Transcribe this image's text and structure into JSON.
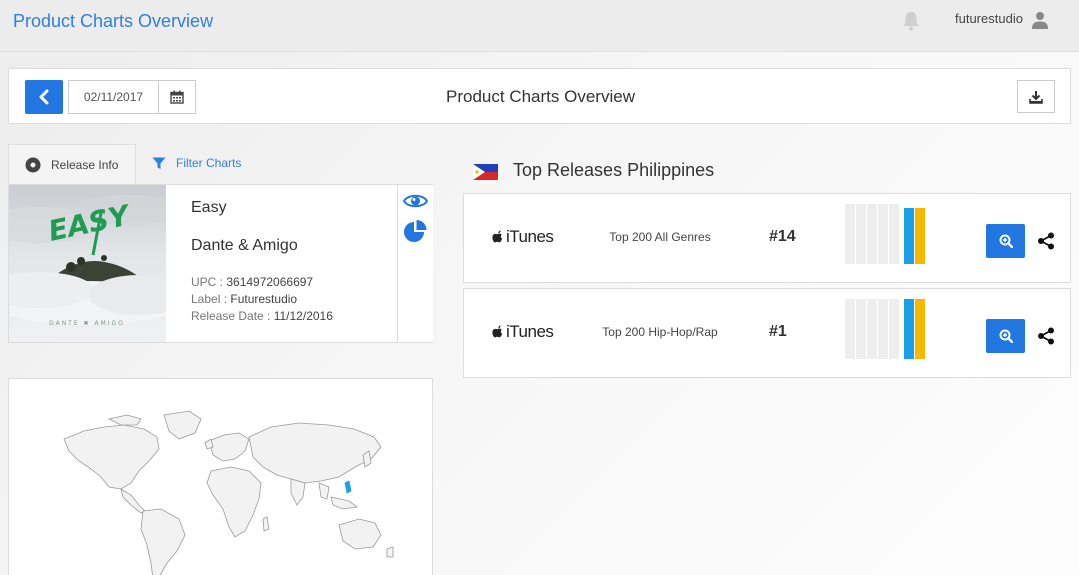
{
  "app": {
    "title": "Product Charts Overview"
  },
  "user": {
    "name": "futurestudio"
  },
  "toolbar": {
    "date": "02/11/2017",
    "title": "Product Charts Overview"
  },
  "tabs": {
    "release_info": "Release Info",
    "filter_charts": "Filter Charts"
  },
  "release": {
    "title": "Easy",
    "artist": "Dante & Amigo",
    "upc_label": "UPC : ",
    "upc": "3614972066697",
    "label_label": "Label : ",
    "label": "Futurestudio",
    "date_label": "Release Date : ",
    "release_date": "11/12/2016",
    "cover_text": "EASY",
    "cover_subtext": "DANTE ✖ AMIGO"
  },
  "top_releases": {
    "title": "Top Releases Philippines",
    "rows": [
      {
        "store": "iTunes",
        "chart": "Top 200 All Genres",
        "rank": "#14"
      },
      {
        "store": "iTunes",
        "chart": "Top 200 Hip-Hop/Rap",
        "rank": "#1"
      }
    ]
  },
  "colors": {
    "accent": "#2176e0",
    "link": "#2f7fdc",
    "bar_blue": "#1aa0e6",
    "bar_yellow": "#f7b800",
    "bar_empty": "#eeeeee"
  },
  "icons": [
    "bell-icon",
    "user-icon",
    "chevron-left-icon",
    "calendar-icon",
    "download-icon",
    "disc-icon",
    "filter-icon",
    "eye-icon",
    "pie-chart-icon",
    "ph-flag-icon",
    "apple-icon",
    "zoom-in-icon",
    "share-icon"
  ]
}
